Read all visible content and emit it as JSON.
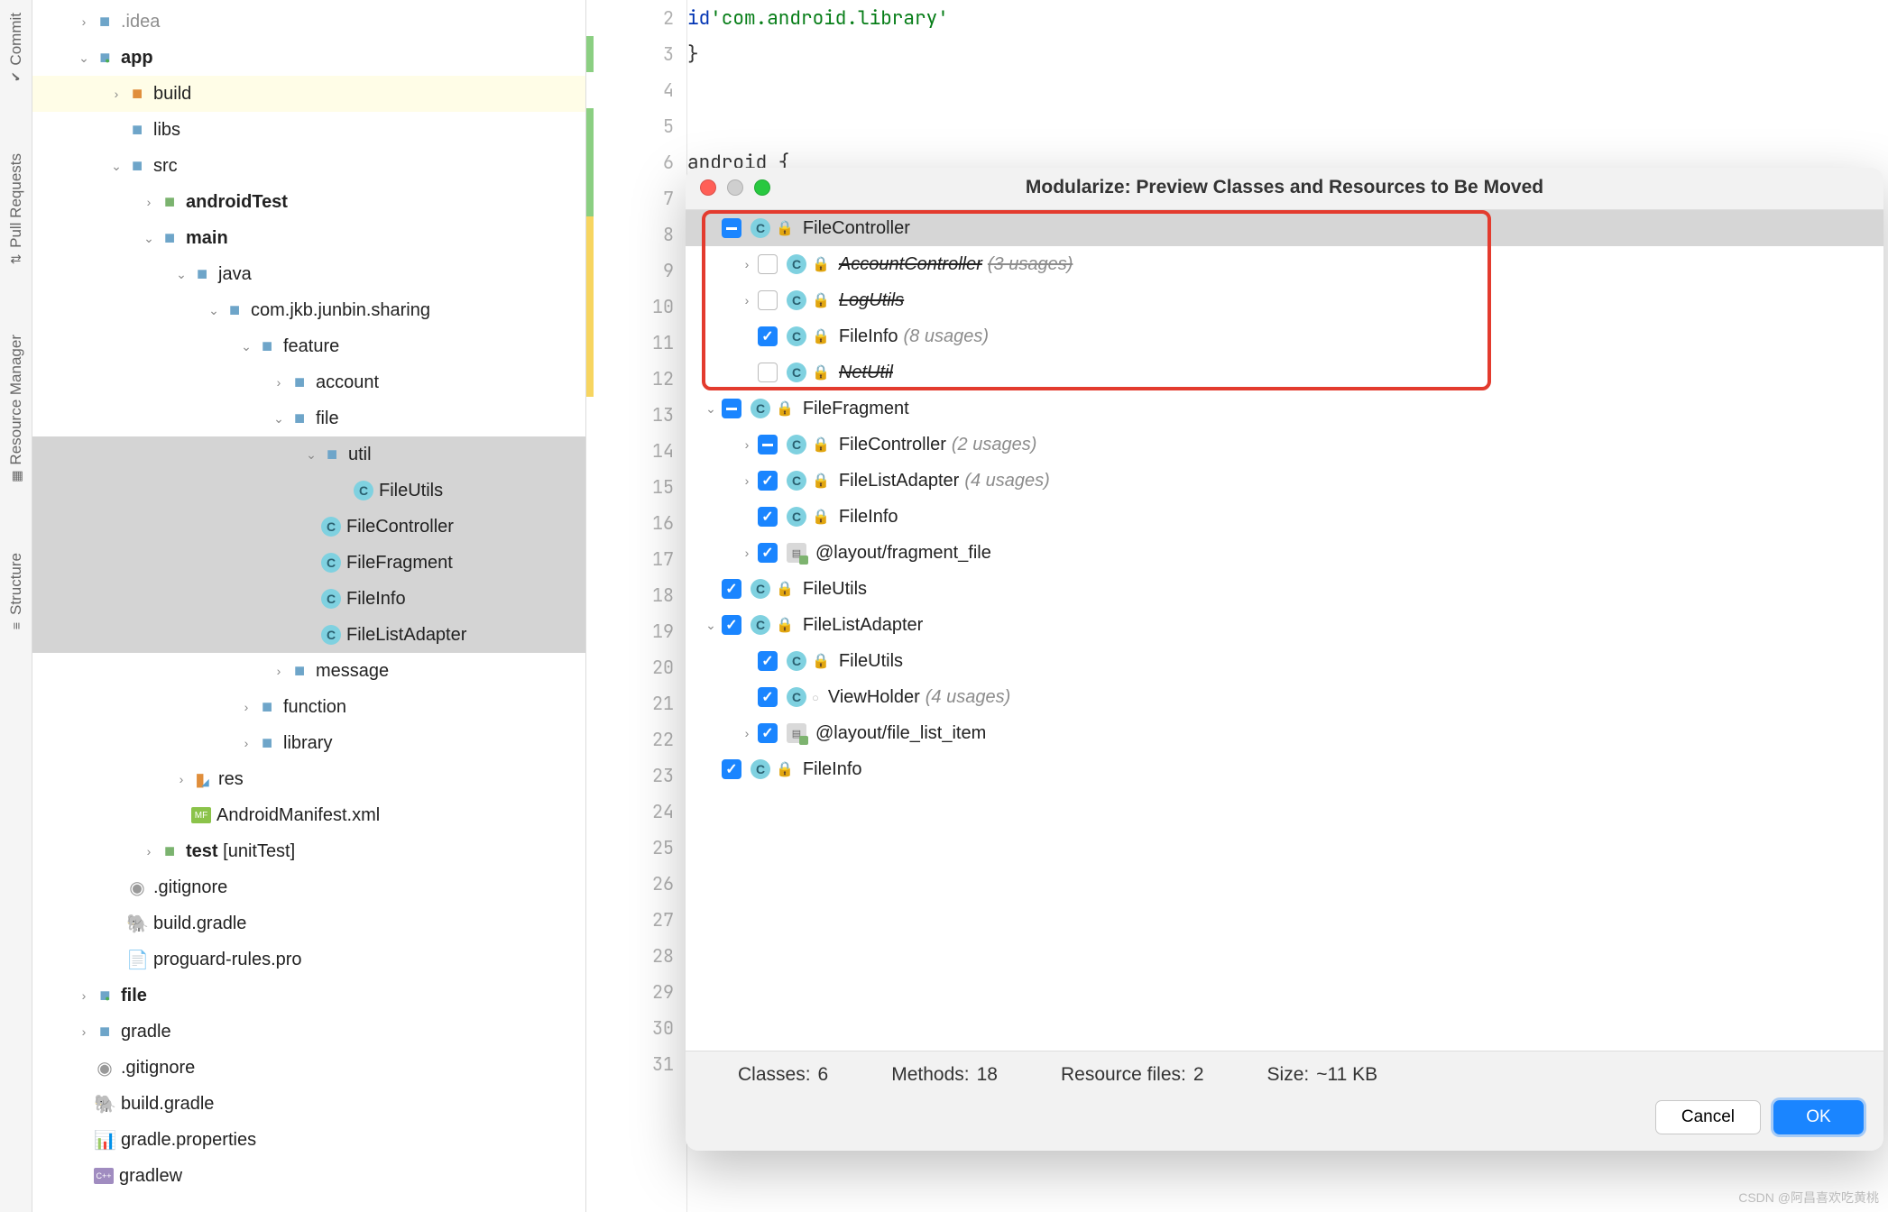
{
  "vert_tabs": [
    "Commit",
    "Pull Requests",
    "Resource Manager",
    "Structure"
  ],
  "tree": [
    {
      "d": 1,
      "a": "right",
      "i": "folder",
      "l": ".idea",
      "muted": true
    },
    {
      "d": 1,
      "a": "down",
      "i": "folder-root",
      "l": "app",
      "bold": true
    },
    {
      "d": 2,
      "a": "right",
      "i": "folder-orange",
      "l": "build",
      "hl": true
    },
    {
      "d": 2,
      "a": "none",
      "i": "folder",
      "l": "libs"
    },
    {
      "d": 2,
      "a": "down",
      "i": "folder",
      "l": "src"
    },
    {
      "d": 3,
      "a": "right",
      "i": "folder-test",
      "l": "androidTest",
      "bold": true
    },
    {
      "d": 3,
      "a": "down",
      "i": "folder",
      "l": "main",
      "bold": true
    },
    {
      "d": 4,
      "a": "down",
      "i": "folder",
      "l": "java"
    },
    {
      "d": 5,
      "a": "down",
      "i": "folder",
      "l": "com.jkb.junbin.sharing"
    },
    {
      "d": 6,
      "a": "down",
      "i": "folder",
      "l": "feature"
    },
    {
      "d": 7,
      "a": "right",
      "i": "folder",
      "l": "account"
    },
    {
      "d": 7,
      "a": "down",
      "i": "folder",
      "l": "file"
    },
    {
      "d": 8,
      "a": "down",
      "i": "folder",
      "l": "util",
      "sel": true
    },
    {
      "d": 9,
      "a": "none",
      "i": "class",
      "l": "FileUtils",
      "sel": true
    },
    {
      "d": 8,
      "a": "none",
      "i": "class",
      "l": "FileController",
      "sel": true
    },
    {
      "d": 8,
      "a": "none",
      "i": "class",
      "l": "FileFragment",
      "sel": true
    },
    {
      "d": 8,
      "a": "none",
      "i": "class",
      "l": "FileInfo",
      "sel": true
    },
    {
      "d": 8,
      "a": "none",
      "i": "class",
      "l": "FileListAdapter",
      "sel": true
    },
    {
      "d": 7,
      "a": "right",
      "i": "folder",
      "l": "message"
    },
    {
      "d": 6,
      "a": "right",
      "i": "folder",
      "l": "function"
    },
    {
      "d": 6,
      "a": "right",
      "i": "folder",
      "l": "library"
    },
    {
      "d": 4,
      "a": "right",
      "i": "res",
      "l": "res"
    },
    {
      "d": 4,
      "a": "none",
      "i": "mf",
      "l": "AndroidManifest.xml"
    },
    {
      "d": 3,
      "a": "right",
      "i": "folder-test",
      "l": "test [unitTest]",
      "boldpart": "test"
    },
    {
      "d": 2,
      "a": "none",
      "i": "gitignore",
      "l": ".gitignore"
    },
    {
      "d": 2,
      "a": "none",
      "i": "gradle",
      "l": "build.gradle"
    },
    {
      "d": 2,
      "a": "none",
      "i": "file",
      "l": "proguard-rules.pro"
    },
    {
      "d": 1,
      "a": "right",
      "i": "folder-root",
      "l": "file",
      "bold": true
    },
    {
      "d": 1,
      "a": "right",
      "i": "folder",
      "l": "gradle"
    },
    {
      "d": 1,
      "a": "none",
      "i": "gitignore",
      "l": ".gitignore"
    },
    {
      "d": 1,
      "a": "none",
      "i": "gradle",
      "l": "build.gradle"
    },
    {
      "d": 1,
      "a": "none",
      "i": "props",
      "l": "gradle.properties"
    },
    {
      "d": 1,
      "a": "none",
      "i": "cpp",
      "l": "gradlew"
    }
  ],
  "gutter_start": 2,
  "gutter_end": 31,
  "code": {
    "l2": "    id 'com.android.library'",
    "l3": "}",
    "l6": "android {"
  },
  "dialog": {
    "title": "Modularize: Preview Classes and Resources to Be Moved",
    "rows": [
      {
        "d": 0,
        "a": "none",
        "cb": "ind",
        "ic": "class",
        "lk": true,
        "n": "FileController",
        "sel": true
      },
      {
        "d": 1,
        "a": "right",
        "cb": "off",
        "ic": "class",
        "lk": true,
        "n": "AccountController",
        "u": "(3 usages)",
        "strike": true
      },
      {
        "d": 1,
        "a": "right",
        "cb": "off",
        "ic": "class",
        "lk": true,
        "n": "LogUtils",
        "strike": true
      },
      {
        "d": 1,
        "a": "none",
        "cb": "chk",
        "ic": "class",
        "lk": true,
        "n": "FileInfo",
        "u": "(8 usages)"
      },
      {
        "d": 1,
        "a": "none",
        "cb": "off",
        "ic": "class",
        "lk": true,
        "n": "NetUtil",
        "strike": true
      },
      {
        "d": 0,
        "a": "down",
        "cb": "ind",
        "ic": "class",
        "lk": true,
        "n": "FileFragment"
      },
      {
        "d": 1,
        "a": "right",
        "cb": "ind",
        "ic": "class",
        "lk": true,
        "n": "FileController",
        "u": "(2 usages)"
      },
      {
        "d": 1,
        "a": "right",
        "cb": "chk",
        "ic": "class",
        "lk": true,
        "n": "FileListAdapter",
        "u": "(4 usages)"
      },
      {
        "d": 1,
        "a": "none",
        "cb": "chk",
        "ic": "class",
        "lk": true,
        "n": "FileInfo"
      },
      {
        "d": 1,
        "a": "right",
        "cb": "chk",
        "ic": "xml",
        "n": "@layout/fragment_file"
      },
      {
        "d": 0,
        "a": "none",
        "cb": "chk",
        "ic": "class",
        "lk": true,
        "n": "FileUtils"
      },
      {
        "d": 0,
        "a": "down",
        "cb": "chk",
        "ic": "class",
        "lk": true,
        "n": "FileListAdapter"
      },
      {
        "d": 1,
        "a": "none",
        "cb": "chk",
        "ic": "class",
        "lk": true,
        "n": "FileUtils"
      },
      {
        "d": 1,
        "a": "none",
        "cb": "chk",
        "ic": "class",
        "pub": true,
        "n": "ViewHolder",
        "u": "(4 usages)"
      },
      {
        "d": 1,
        "a": "right",
        "cb": "chk",
        "ic": "xml",
        "n": "@layout/file_list_item"
      },
      {
        "d": 0,
        "a": "none",
        "cb": "chk",
        "ic": "class",
        "lk": true,
        "n": "FileInfo"
      }
    ],
    "stats": {
      "classes_l": "Classes:",
      "classes_v": "6",
      "methods_l": "Methods:",
      "methods_v": "18",
      "res_l": "Resource files:",
      "res_v": "2",
      "size_l": "Size:",
      "size_v": "~11 KB"
    },
    "cancel": "Cancel",
    "ok": "OK"
  },
  "watermark": "CSDN @阿昌喜欢吃黄桃"
}
